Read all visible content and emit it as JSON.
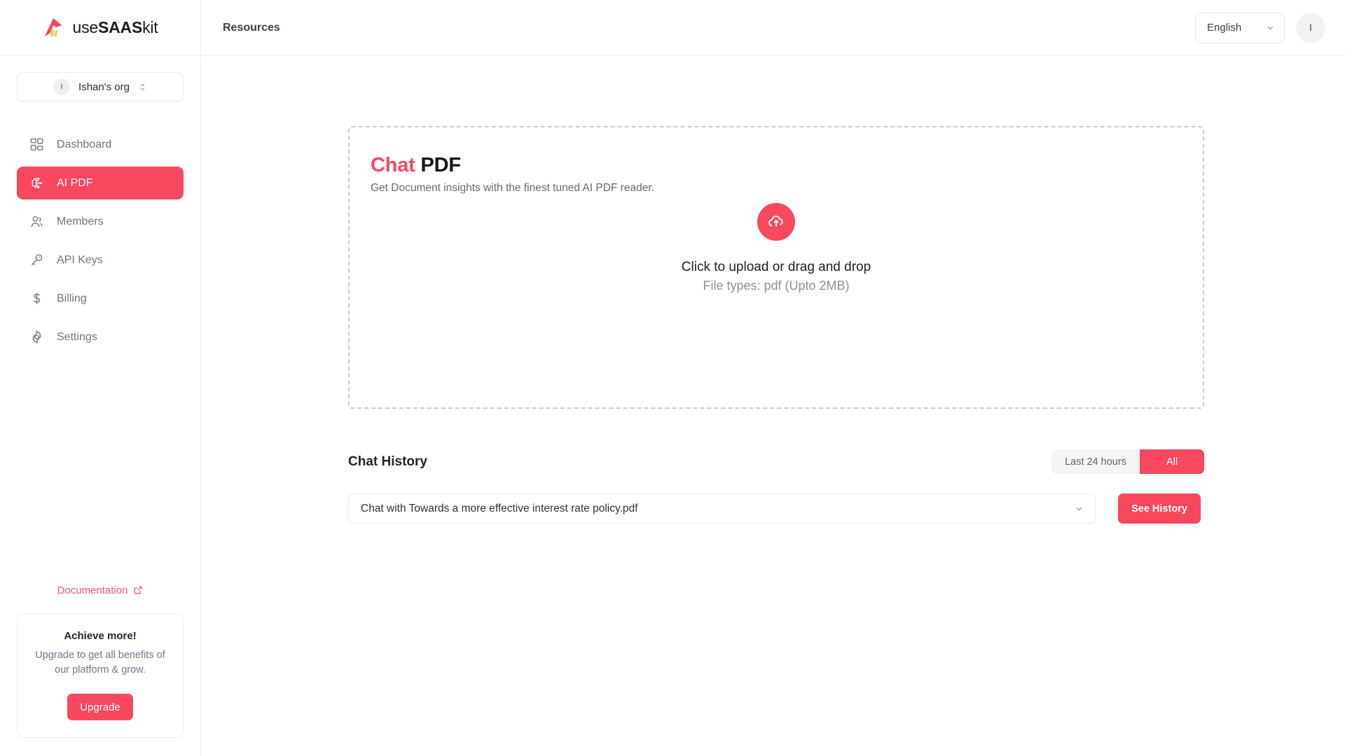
{
  "brand": {
    "name_plain_1": "use",
    "name_bold": "SAAS",
    "name_plain_2": "kit",
    "logo_icon": "usesaaskit-logo-icon",
    "accent_color": "#f8485e",
    "logo_secondary_color": "#ffc93c"
  },
  "topbar": {
    "links": [
      {
        "label": "Resources"
      }
    ],
    "language": {
      "value": "English",
      "chevron_icon": "chevron-down-icon"
    },
    "user_avatar_initial": "I"
  },
  "sidebar": {
    "org": {
      "avatar_initial": "I",
      "name": "Ishan's org",
      "switch_icon": "chevron-up-down-icon"
    },
    "items": [
      {
        "label": "Dashboard",
        "icon": "grid-dashboard-icon",
        "active": false
      },
      {
        "label": "AI PDF",
        "icon": "brain-ai-icon",
        "active": true
      },
      {
        "label": "Members",
        "icon": "user-group-icon",
        "active": false
      },
      {
        "label": "API Keys",
        "icon": "key-icon",
        "active": false
      },
      {
        "label": "Billing",
        "icon": "dollar-sign-icon",
        "active": false
      },
      {
        "label": "Settings",
        "icon": "gear-icon",
        "active": false
      }
    ],
    "documentation": {
      "label": "Documentation",
      "icon": "external-link-icon"
    },
    "upgrade_card": {
      "title": "Achieve more!",
      "description": "Upgrade to get all benefits of our platform & grow.",
      "button_label": "Upgrade"
    }
  },
  "main": {
    "upload_card": {
      "title_accent": "Chat",
      "title_rest": "PDF",
      "subtitle": "Get Document insights with the finest tuned AI PDF reader.",
      "dropzone": {
        "icon": "cloud-upload-icon",
        "primary_text": "Click to upload or drag and drop",
        "secondary_text": "File types: pdf (Upto 2MB)"
      }
    },
    "chat_history": {
      "title": "Chat History",
      "filters": [
        {
          "label": "Last 24 hours",
          "active": false
        },
        {
          "label": "All",
          "active": true
        }
      ],
      "selected_chat": "Chat with Towards a more effective interest rate policy.pdf",
      "select_chevron_icon": "chevron-down-icon",
      "see_history_label": "See History"
    }
  }
}
